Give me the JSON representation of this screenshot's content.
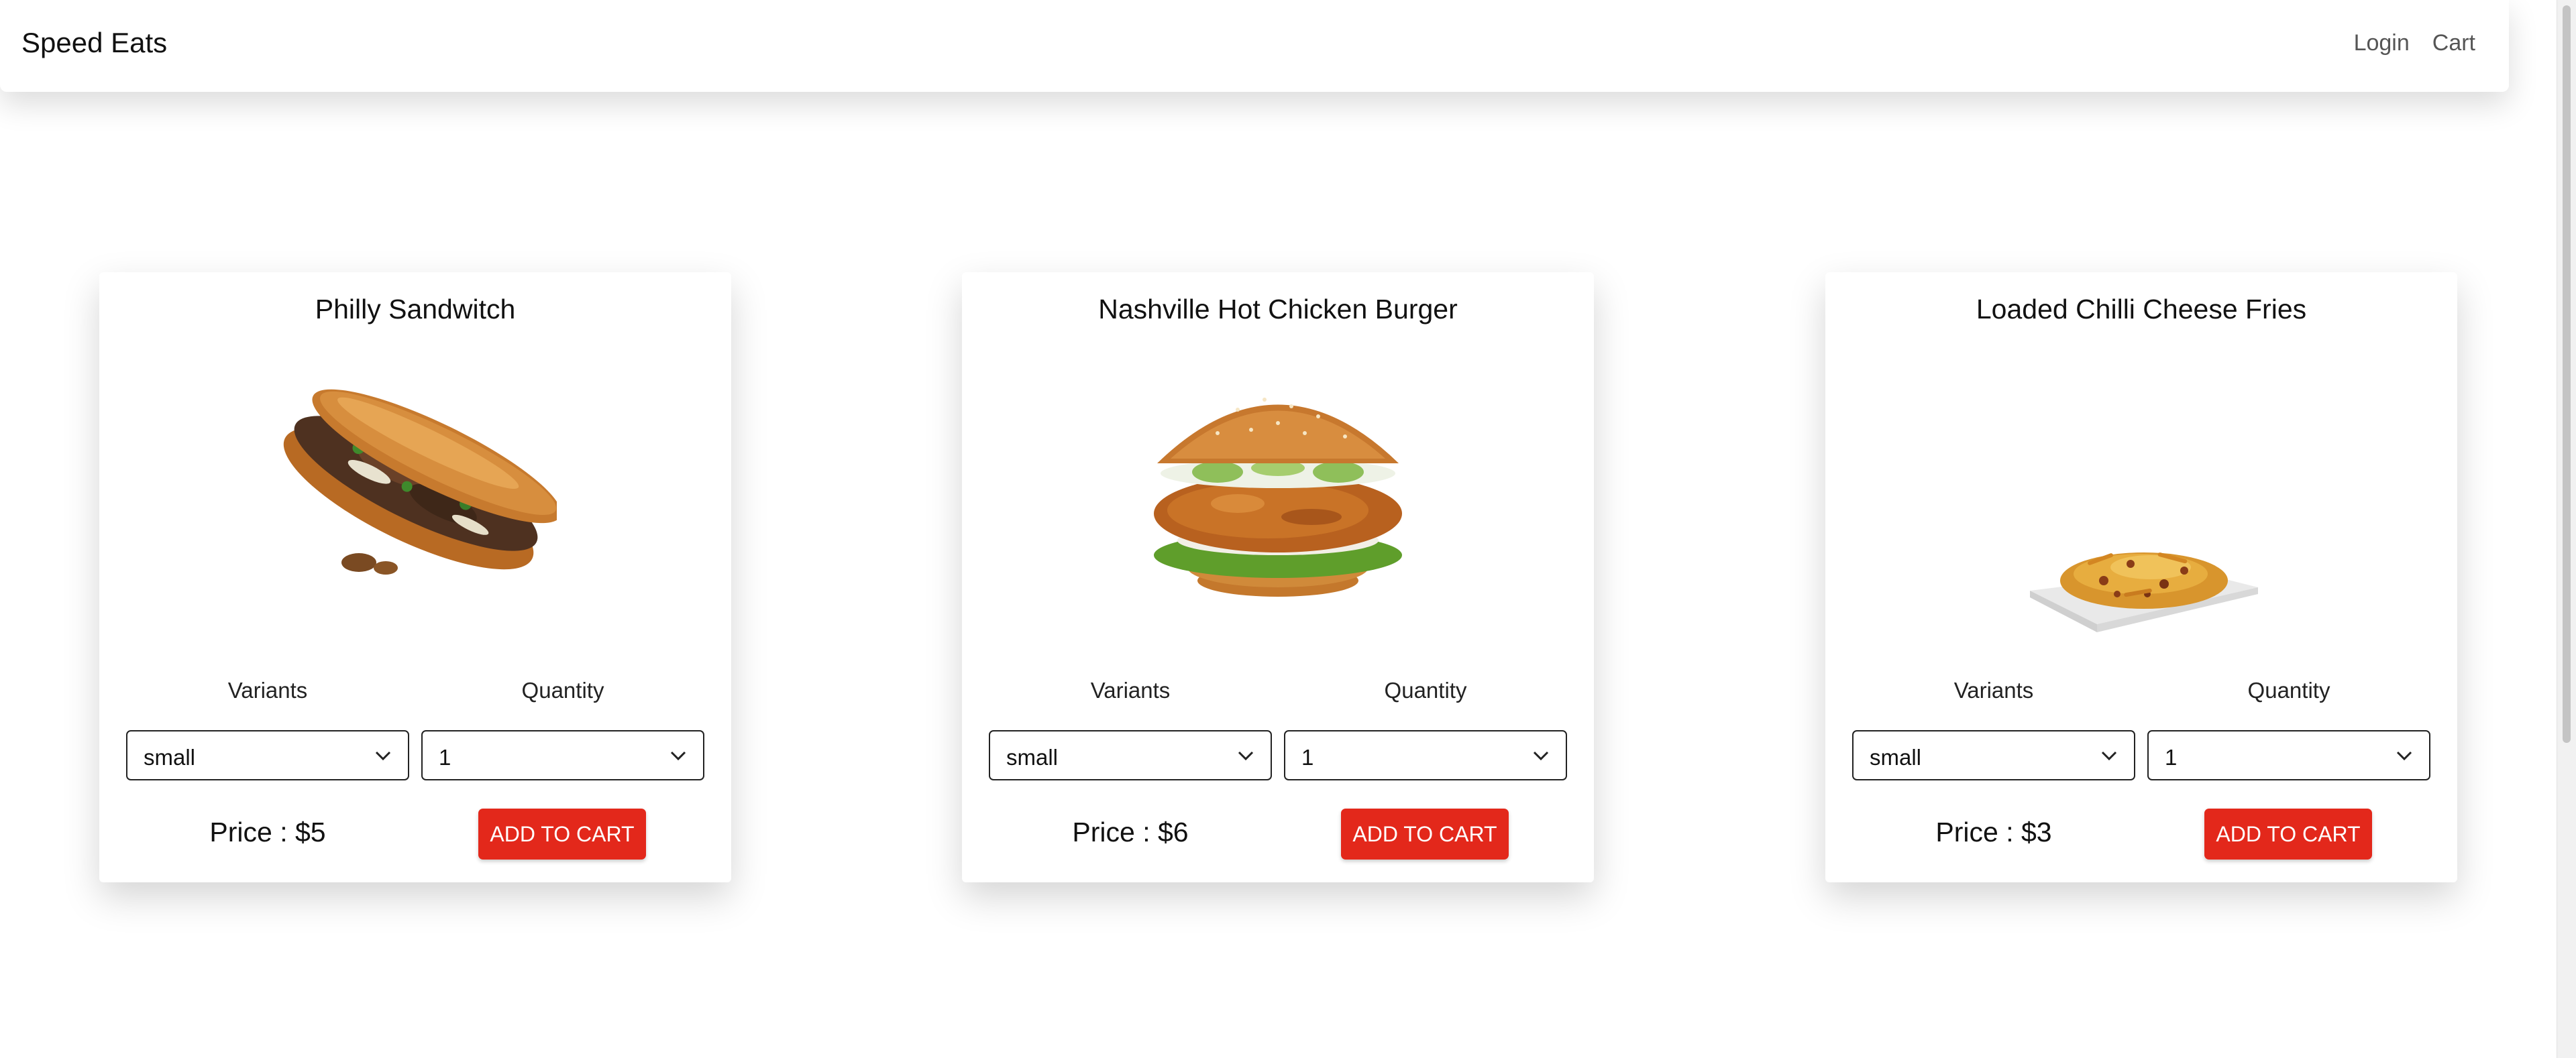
{
  "navbar": {
    "brand": "Speed Eats",
    "links": {
      "login": "Login",
      "cart": "Cart"
    }
  },
  "labels": {
    "variants": "Variants",
    "quantity": "Quantity"
  },
  "products": [
    {
      "name": "Philly Sandwitch",
      "variant": "small",
      "quantity": "1",
      "price": "Price : $5",
      "button": "ADD TO CART",
      "image_icon": "philly-sandwich-image"
    },
    {
      "name": "Nashville Hot Chicken Burger",
      "variant": "small",
      "quantity": "1",
      "price": "Price : $6",
      "button": "ADD TO CART",
      "image_icon": "chicken-burger-image"
    },
    {
      "name": "Loaded Chilli Cheese Fries",
      "variant": "small",
      "quantity": "1",
      "price": "Price : $3",
      "button": "ADD TO CART",
      "image_icon": "cheese-fries-image"
    }
  ],
  "colors": {
    "accent": "#e3281b",
    "navbar_bg": "#ffffff",
    "text": "#111111"
  }
}
